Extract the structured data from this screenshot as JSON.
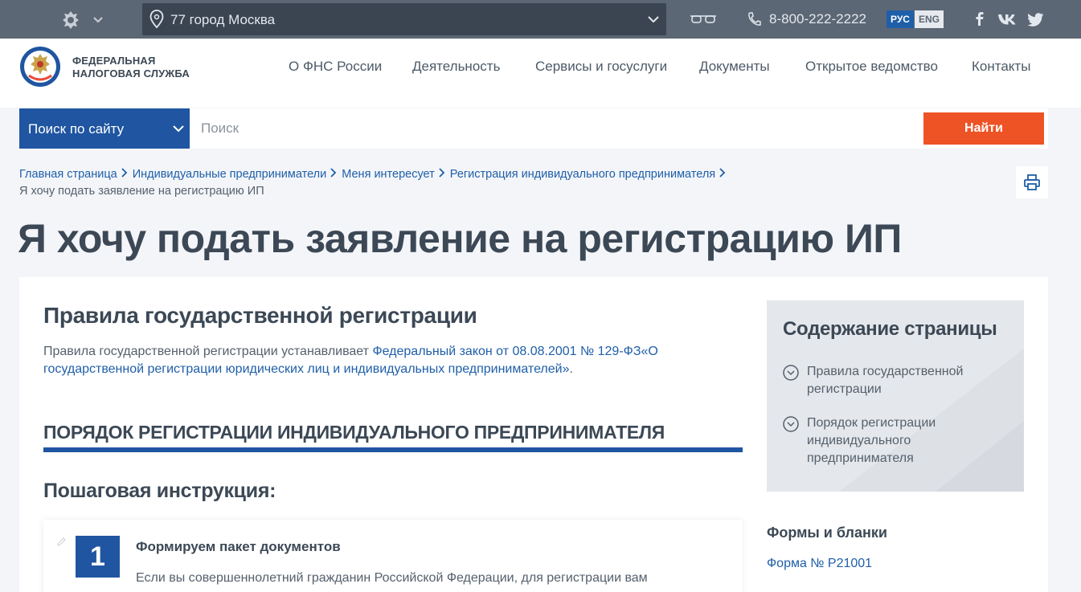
{
  "topbar": {
    "region": "77 город Москва",
    "phone": "8-800-222-2222",
    "lang_ru": "РУС",
    "lang_en": "ENG",
    "social": [
      "facebook-icon",
      "vk-icon",
      "twitter-icon"
    ]
  },
  "header": {
    "logo_line1": "ФЕДЕРАЛЬНАЯ",
    "logo_line2": "НАЛОГОВАЯ СЛУЖБА",
    "nav": [
      "О ФНС России",
      "Деятельность",
      "Сервисы и госуслуги",
      "Документы",
      "Открытое ведомство",
      "Контакты"
    ]
  },
  "search": {
    "category": "Поиск по сайту",
    "placeholder": "Поиск",
    "button": "Найти"
  },
  "breadcrumb": {
    "items": [
      "Главная страница",
      "Индивидуальные предприниматели",
      "Меня интересует",
      "Регистрация индивидуального предпринимателя"
    ],
    "current": "Я хочу подать заявление на регистрацию ИП"
  },
  "page_title": "Я хочу подать заявление на регистрацию ИП",
  "content": {
    "h2": "Правила государственной регистрации",
    "intro_text": "Правила государственной регистрации устанавливает ",
    "intro_link": "Федеральный закон от 08.08.2001 № 129-ФЗ«О государственной регистрации юридических лиц и индивидуальных предпринимателей»",
    "intro_end": ".",
    "h3": "ПОРЯДОК РЕГИСТРАЦИИ ИНДИВИДУАЛЬНОГО ПРЕДПРИНИМАТЕЛЯ",
    "h4": "Пошаговая инструкция:",
    "step": {
      "number": "1",
      "title": "Формируем пакет документов",
      "text": "Если вы совершеннолетний гражданин Российской Федерации, для регистрации вам"
    }
  },
  "toc": {
    "title": "Содержание страницы",
    "items": [
      "Правила государственной регистрации",
      "Порядок регистрации индивидуального предпринимателя"
    ]
  },
  "forms": {
    "title": "Формы и бланки",
    "link": "Форма № Р21001"
  },
  "colors": {
    "topbar": "#5c6775",
    "primary_blue": "#1f55a1",
    "link_blue": "#1f5fa8",
    "accent_orange": "#ee5325"
  }
}
